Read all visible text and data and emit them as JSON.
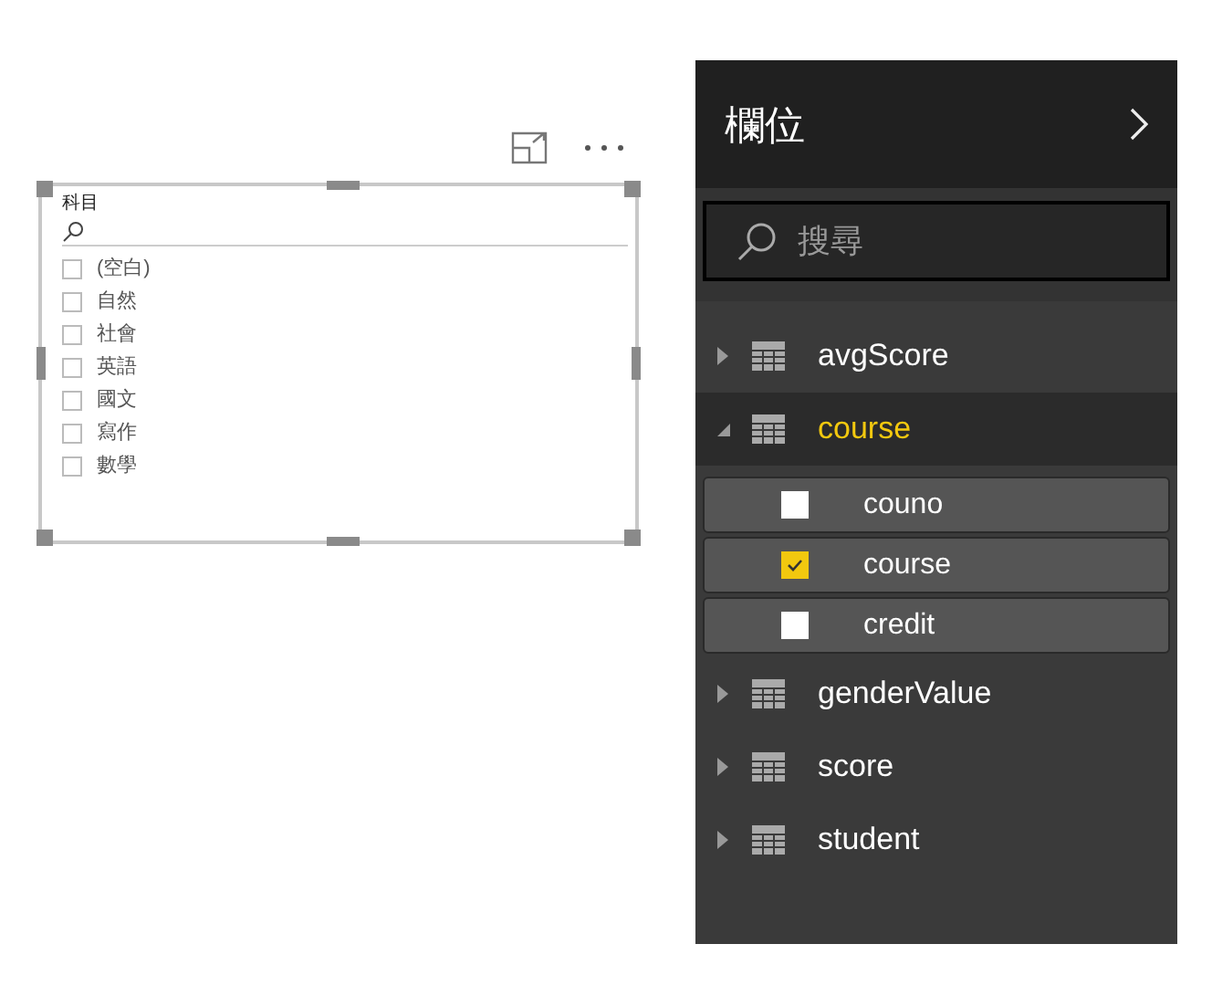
{
  "slicer": {
    "title": "科目",
    "items": [
      {
        "label": "(空白)",
        "checked": false
      },
      {
        "label": "自然",
        "checked": false
      },
      {
        "label": "社會",
        "checked": false
      },
      {
        "label": "英語",
        "checked": false
      },
      {
        "label": "國文",
        "checked": false
      },
      {
        "label": "寫作",
        "checked": false
      },
      {
        "label": "數學",
        "checked": false
      }
    ]
  },
  "fields_pane": {
    "title": "欄位",
    "search": {
      "placeholder": "搜尋"
    },
    "tables": [
      {
        "name": "avgScore",
        "expanded": false,
        "selected": false
      },
      {
        "name": "course",
        "expanded": true,
        "selected": true,
        "fields": [
          {
            "name": "couno",
            "checked": false
          },
          {
            "name": "course",
            "checked": true
          },
          {
            "name": "credit",
            "checked": false
          }
        ]
      },
      {
        "name": "genderValue",
        "expanded": false,
        "selected": false
      },
      {
        "name": "score",
        "expanded": false,
        "selected": false
      },
      {
        "name": "student",
        "expanded": false,
        "selected": false
      }
    ]
  }
}
